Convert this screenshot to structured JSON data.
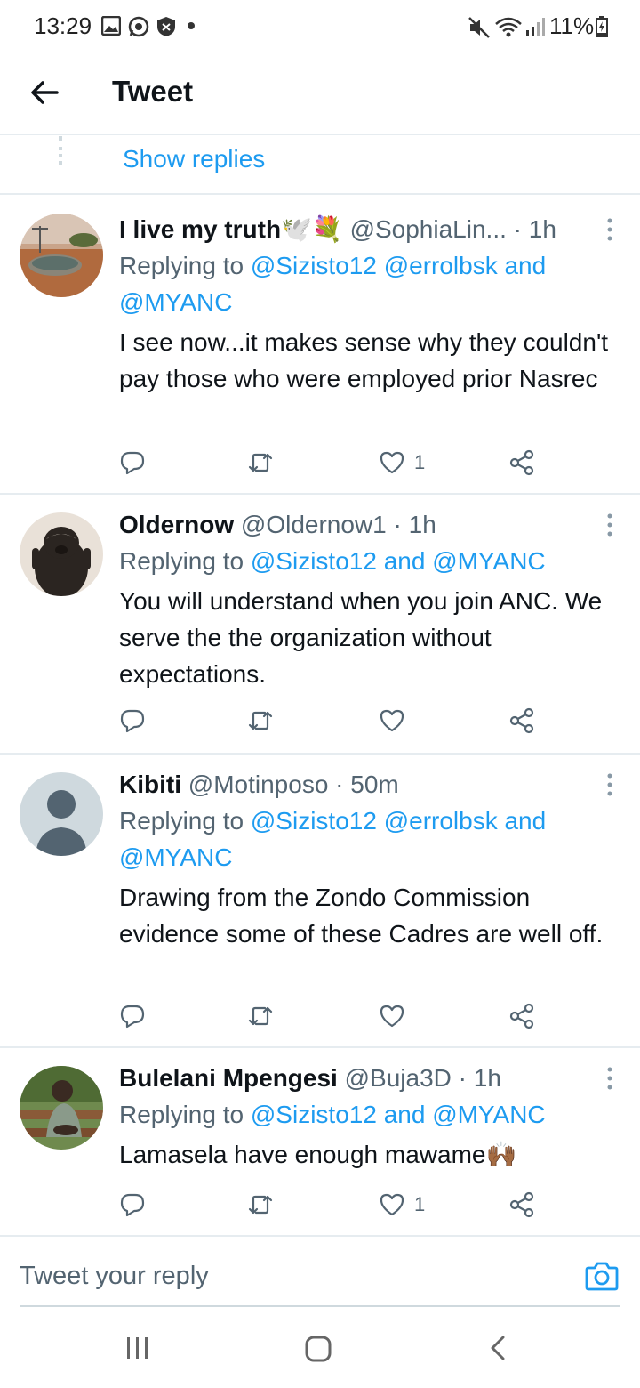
{
  "status_bar": {
    "time": "13:29",
    "battery": "11%"
  },
  "header": {
    "title": "Tweet"
  },
  "thread": {
    "show_replies": "Show replies"
  },
  "tweets": [
    {
      "name": "I live my truth🕊️💐",
      "handle": "@SophiaLin...",
      "time": "· 1h",
      "replying_prefix": "Replying to",
      "mentions_line1": "@Sizisto12 @errolbsk and",
      "mentions_line2": "@MYANC",
      "text": "I see now...it makes sense why they couldn't pay those who were employed prior Nasrec",
      "like_count": "1"
    },
    {
      "name": "Oldernow",
      "handle": "@Oldernow1",
      "time": "· 1h",
      "replying_prefix": "Replying to",
      "mentions_line1": "@Sizisto12 and @MYANC",
      "mentions_line2": "",
      "text": "You will understand when you join ANC. We serve the the organization without expectations.",
      "like_count": ""
    },
    {
      "name": "Kibiti",
      "handle": "@Motinposo",
      "time": "· 50m",
      "replying_prefix": "Replying to",
      "mentions_line1": "@Sizisto12 @errolbsk and",
      "mentions_line2": "@MYANC",
      "text": "Drawing from the Zondo Commission evidence some of these Cadres are well off.",
      "like_count": ""
    },
    {
      "name": "Bulelani Mpengesi",
      "handle": "@Buja3D",
      "time": "· 1h",
      "replying_prefix": "Replying to",
      "mentions_line1": "@Sizisto12 and @MYANC",
      "mentions_line2": "",
      "text": "Lamasela have enough mawame🙌🏾",
      "like_count": "1"
    }
  ],
  "composer": {
    "placeholder": "Tweet your reply"
  },
  "colors": {
    "accent": "#1d9bf0",
    "text": "#0f1419",
    "muted": "#536471",
    "divider": "#e6ecf0"
  },
  "icons": [
    "back-arrow-icon",
    "reply-icon",
    "retweet-icon",
    "like-icon",
    "share-icon",
    "more-icon",
    "camera-icon",
    "recents-icon",
    "home-icon",
    "back-nav-icon"
  ]
}
